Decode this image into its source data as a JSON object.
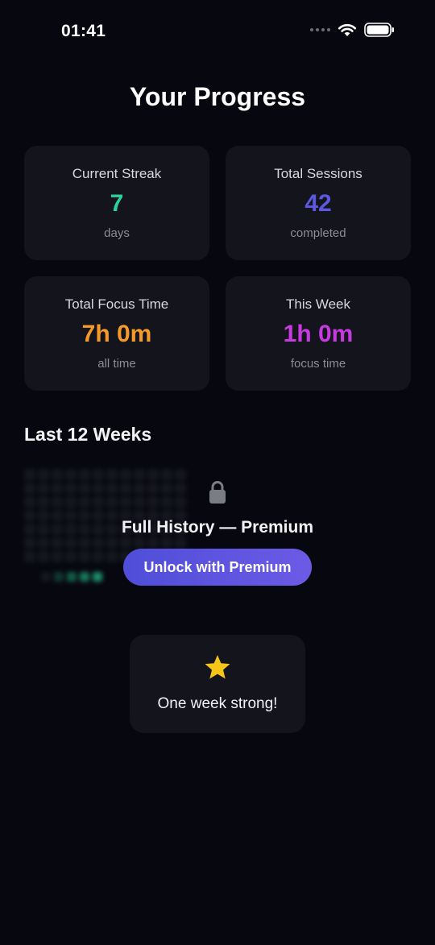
{
  "status_bar": {
    "time": "01:41"
  },
  "title": "Your Progress",
  "stats": [
    {
      "label": "Current Streak",
      "value": "7",
      "unit": "days",
      "color": "#2ad19a"
    },
    {
      "label": "Total Sessions",
      "value": "42",
      "unit": "completed",
      "color": "#5b58dd"
    },
    {
      "label": "Total Focus Time",
      "value": "7h 0m",
      "unit": "all time",
      "color": "#f39a2b"
    },
    {
      "label": "This Week",
      "value": "1h 0m",
      "unit": "focus time",
      "color": "#c73ae0"
    }
  ],
  "history": {
    "title": "Last 12 Weeks",
    "locked_title": "Full History — Premium",
    "unlock_label": "Unlock with Premium"
  },
  "achievement": {
    "icon": "star-icon",
    "text": "One week strong!"
  },
  "colors": {
    "background": "#07080f",
    "card": "#13141c",
    "accent": "#5b58dd",
    "heat": "#1f9c72"
  }
}
